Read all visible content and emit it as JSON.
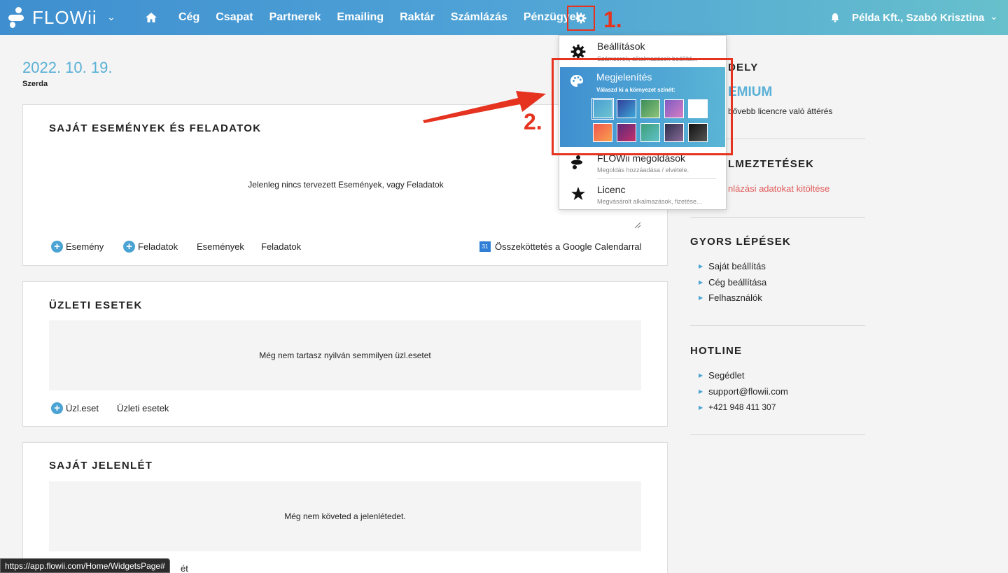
{
  "header": {
    "logo_text": "FLOWii",
    "nav": [
      "Cég",
      "Csapat",
      "Partnerek",
      "Emailing",
      "Raktár",
      "Számlázás",
      "Pénzügyek"
    ],
    "user": "Példa Kft., Szabó Krisztina",
    "step1_label": "1."
  },
  "page": {
    "date": "2022. 10. 19.",
    "weekday": "Szerda"
  },
  "events_card": {
    "title": "SAJÁT ESEMÉNYEK ÉS FELADATOK",
    "empty": "Jelenleg nincs tervezett Események, vagy Feladatok",
    "add_event": "Esemény",
    "add_task": "Feladatok",
    "events_link": "Események",
    "tasks_link": "Feladatok",
    "google_calendar": "Összeköttetés a Google Calendarral",
    "calendar_icon_text": "31"
  },
  "business_card": {
    "title": "ÜZLETI ESETEK",
    "empty": "Még nem tartasz nyilván semmilyen üzl.esetet",
    "add_case": "Üzl.eset",
    "cases_link": "Üzleti esetek"
  },
  "attendance_card": {
    "title": "SAJÁT JELENLÉT",
    "empty": "Még nem követed a jelenlétedet.",
    "partial_action": "ét"
  },
  "right_column": {
    "license_title_partial": "DELY",
    "license_name_partial": "EMIUM",
    "license_note_partial": "bővebb licencre való áttérés",
    "notifications_title_partial": "LMEZTETÉSEK",
    "notifications_link_partial": "nlázási adatokat kitöltése",
    "quick_steps_title": "GYORS LÉPÉSEK",
    "quick_steps": [
      "Saját beállítás",
      "Cég beállítása",
      "Felhasználók"
    ],
    "hotline_title": "HOTLINE",
    "hotline": [
      "Segédlet",
      "support@flowii.com",
      "+421 948 411 307"
    ]
  },
  "dropdown": {
    "settings_title": "Beállítások",
    "settings_sub": "Számsorok, alkalmazások beállítá...",
    "appearance_title": "Megjelenítés",
    "appearance_hint": "Válaszd ki a környezet színét:",
    "solutions_title": "FLOWii megoldások",
    "solutions_sub": "Megoldás hozzáadása / elvétele.",
    "license_title": "Licenc",
    "license_sub": "Megvásárolt alkalmazások, fizetése...",
    "step2_label": "2.",
    "swatches": [
      [
        "#4a9fd3",
        "#6cc3d0"
      ],
      [
        "#2f3f9a",
        "#3fa8d8"
      ],
      [
        "#3c8d5a",
        "#8fc47a"
      ],
      [
        "#7e5bc2",
        "#d77fc4"
      ],
      [
        "#ffffff",
        "#ffffff"
      ],
      [
        "#f0554f",
        "#f9a34d"
      ],
      [
        "#5b2a7a",
        "#c4306b"
      ],
      [
        "#3f9e7a",
        "#5fc2c8"
      ],
      [
        "#2c2f4a",
        "#8a6a9a"
      ],
      [
        "#111111",
        "#555555"
      ]
    ]
  },
  "statusbar": {
    "url": "https://app.flowii.com/Home/WidgetsPage#"
  },
  "colors": {
    "accent": "#4aa3d3",
    "annotation": "#e53320"
  }
}
